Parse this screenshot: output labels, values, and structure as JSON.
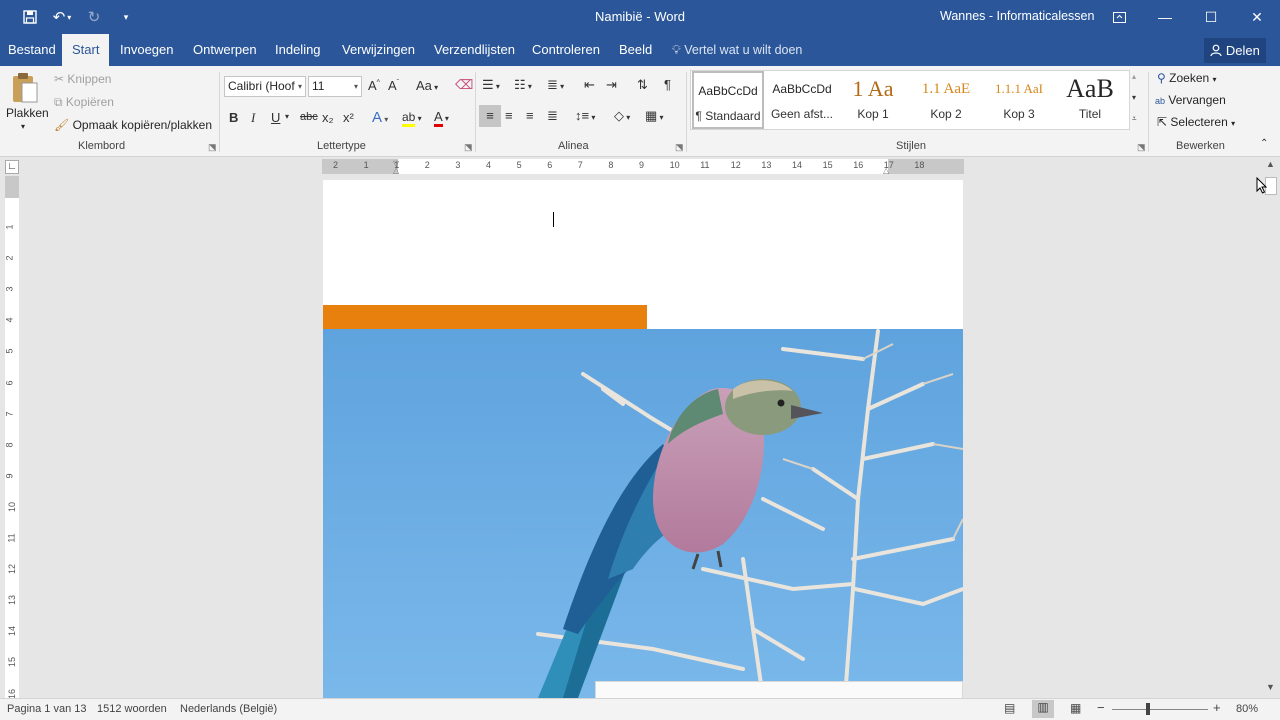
{
  "titlebar": {
    "title": "Namibië  -  Word",
    "user": "Wannes - Informaticalessen"
  },
  "menu": {
    "tabs": [
      "Bestand",
      "Start",
      "Invoegen",
      "Ontwerpen",
      "Indeling",
      "Verwijzingen",
      "Verzendlijsten",
      "Controleren",
      "Beeld"
    ],
    "tell_me": "Vertel wat u wilt doen",
    "share": "Delen"
  },
  "ribbon": {
    "clipboard": {
      "paste": "Plakken",
      "cut": "Knippen",
      "copy": "Kopiëren",
      "format_painter": "Opmaak kopiëren/plakken",
      "label": "Klembord"
    },
    "font": {
      "name": "Calibri (Hoof",
      "size": "11",
      "label": "Lettertype",
      "bold": "B",
      "italic": "I",
      "underline": "U",
      "strike": "abc",
      "sub": "x₂",
      "sup": "x²",
      "case": "Aa"
    },
    "paragraph": {
      "label": "Alinea"
    },
    "styles": {
      "label": "Stijlen",
      "items": [
        {
          "sample": "AaBbCcDd",
          "label": "¶ Standaard"
        },
        {
          "sample": "AaBbCcDd",
          "label": "Geen afst..."
        },
        {
          "sample": "1  Aa",
          "label": "Kop 1"
        },
        {
          "sample": "1.1  AaE",
          "label": "Kop 2"
        },
        {
          "sample": "1.1.1  AaI",
          "label": "Kop 3"
        },
        {
          "sample": "AaB",
          "label": "Titel"
        }
      ]
    },
    "editing": {
      "find": "Zoeken",
      "replace": "Vervangen",
      "select": "Selecteren",
      "label": "Bewerken"
    }
  },
  "ruler": {
    "h_ticks": [
      "2",
      "1",
      "1",
      "2",
      "3",
      "4",
      "5",
      "6",
      "7",
      "8",
      "9",
      "10",
      "11",
      "12",
      "13",
      "14",
      "15",
      "16",
      "17",
      "18"
    ],
    "v_ticks": [
      "1",
      "2",
      "3",
      "4",
      "5",
      "6",
      "7",
      "8",
      "9",
      "10",
      "11",
      "12",
      "13",
      "14",
      "15",
      "16"
    ]
  },
  "status": {
    "page": "Pagina 1 van 13",
    "words": "1512 woorden",
    "language": "Nederlands (België)",
    "zoom": "80%"
  },
  "colors": {
    "word_blue": "#2b579a",
    "accent_orange": "#e8800e",
    "sky": "#6aaee0"
  },
  "icons": [
    "save-icon",
    "undo-icon",
    "redo-icon",
    "customize-icon",
    "ribbon-display-icon",
    "minimize-icon",
    "maximize-icon",
    "close-icon",
    "lightbulb-icon",
    "person-icon"
  ]
}
